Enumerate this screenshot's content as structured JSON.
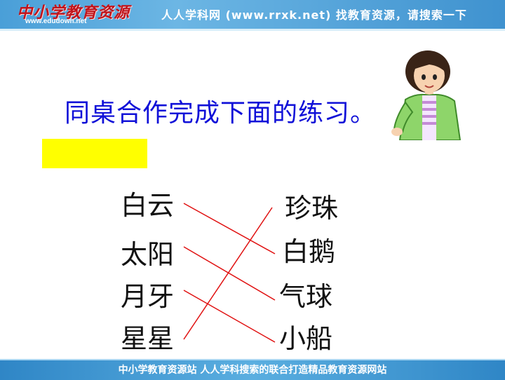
{
  "header": {
    "logo_text": "中小学教育资源",
    "logo_url": "www.edudown.net",
    "tagline": "人人学科网 (www.rrxk.net) 找教育资源，请搜索一下"
  },
  "title": "同桌合作完成下面的练习。",
  "left_words": [
    "白云",
    "太阳",
    "月牙",
    "星星"
  ],
  "right_words": [
    "珍珠",
    "白鹅",
    "气球",
    "小船"
  ],
  "matches": [
    {
      "left": "白云",
      "right": "白鹅"
    },
    {
      "left": "太阳",
      "right": "气球"
    },
    {
      "left": "月牙",
      "right": "小船"
    },
    {
      "left": "星星",
      "right": "珍珠"
    }
  ],
  "line_color": "#e01010",
  "title_color": "#1010d8",
  "highlight_color": "#ffff00",
  "footer": {
    "text": "中小学教育资源站 人人学科搜索的联合打造精品教育资源网站"
  }
}
